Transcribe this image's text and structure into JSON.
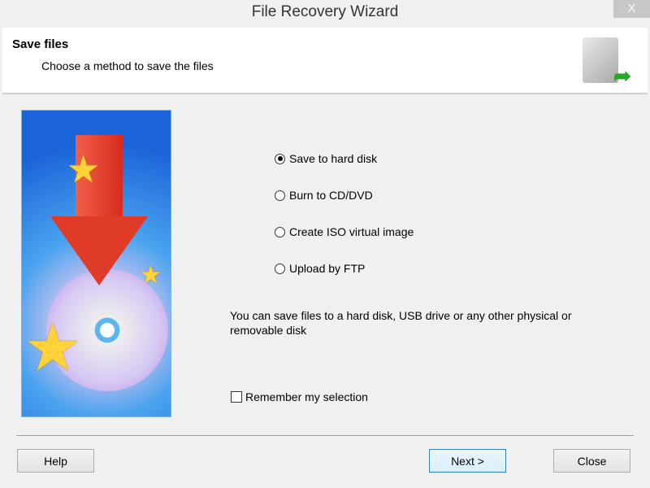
{
  "window": {
    "title": "File Recovery Wizard",
    "close_label": "X"
  },
  "header": {
    "title": "Save files",
    "subtitle": "Choose a method to save the files"
  },
  "options": [
    {
      "label": "Save to hard disk",
      "selected": true
    },
    {
      "label": "Burn to CD/DVD",
      "selected": false
    },
    {
      "label": "Create ISO virtual image",
      "selected": false
    },
    {
      "label": "Upload by FTP",
      "selected": false
    }
  ],
  "description": "You can save files to a hard disk, USB drive or any other physical or removable disk",
  "remember": {
    "label": "Remember my selection",
    "checked": false
  },
  "buttons": {
    "help": "Help",
    "next": "Next >",
    "close": "Close"
  }
}
